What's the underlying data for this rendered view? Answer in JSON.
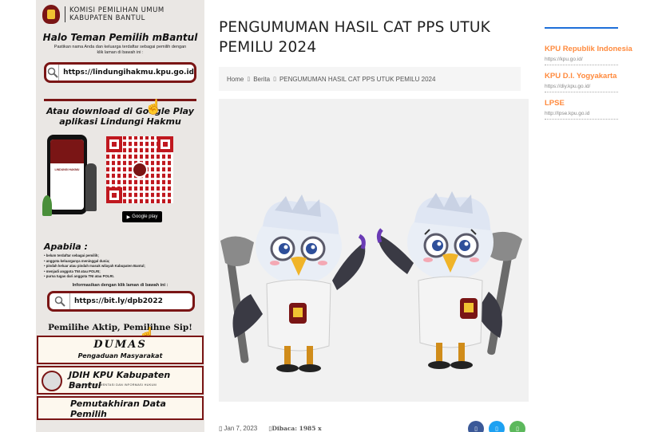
{
  "banner": {
    "kpu_title_line1": "KOMISI PEMILIHAN UMUM",
    "kpu_title_line2": "KABUPATEN BANTUL",
    "halo_title": "Halo Teman Pemilih mBantul",
    "halo_sub": "Pastikan nama Anda dan keluarga terdaftar sebagai pemilih dengan klik laman di bawah ini :",
    "url1": "https://lindungihakmu.kpu.go.id",
    "gp_title_line1": "Atau download di Google Play",
    "gp_title_line2": "aplikasi Lindungi Hakmu",
    "gplay_label": "Google play",
    "apabila_title": "Apabila :",
    "apabila_items": [
      "belum terdaftar sebagai pemilih;",
      "anggota keluarganya meninggal dunia;",
      "pindah keluar atau pindah masuk wilayah Kabupaten Bantul;",
      "menjadi anggota TNI atau POLRI;",
      "purna tugas dari anggota TNI atau POLRI."
    ],
    "info_text": "Informasikan dengan klik laman di bawah ini :",
    "url2": "https://bit.ly/dpb2022",
    "slogan": "Pemilihe Aktip, Pemilihne Sip!",
    "dumas_title": "DUMAS",
    "dumas_sub": "Pengaduan Masyarakat",
    "jdih_title": "JDIH KPU Kabupaten Bantul",
    "jdih_sub": "JARINGAN DOKUMENTASI DAN INFORMASI HUKUM",
    "pemut_title": "Pemutakhiran Data Pemilih"
  },
  "post": {
    "title": "PENGUMUMAN HASIL CAT PPS UTUK PEMILU 2024",
    "date": "Jan 7, 2023",
    "views": "Dibaca: 1985 x"
  },
  "breadcrumb": {
    "home": "Home",
    "category": "Berita",
    "current": "PENGUMUMAN HASIL CAT PPS UTUK PEMILU 2024"
  },
  "sidebar": {
    "links": [
      {
        "name": "KPU Republik Indonesia",
        "url": "https://kpu.go.id/"
      },
      {
        "name": "KPU D.I. Yogyakarta",
        "url": "https://diy.kpu.go.id/"
      },
      {
        "name": "LPSE",
        "url": "http://lpse.kpu.go.id"
      }
    ]
  },
  "colors": {
    "accent_orange": "#ff8a3d",
    "banner_red": "#7a1515",
    "share_facebook": "#3b5998",
    "share_twitter": "#1da1f2",
    "share_whatsapp": "#5cb85c"
  },
  "icons": [
    "search-icon",
    "pointer-hand-icon",
    "calendar-icon",
    "eye-icon",
    "facebook-icon",
    "twitter-icon",
    "whatsapp-icon"
  ]
}
